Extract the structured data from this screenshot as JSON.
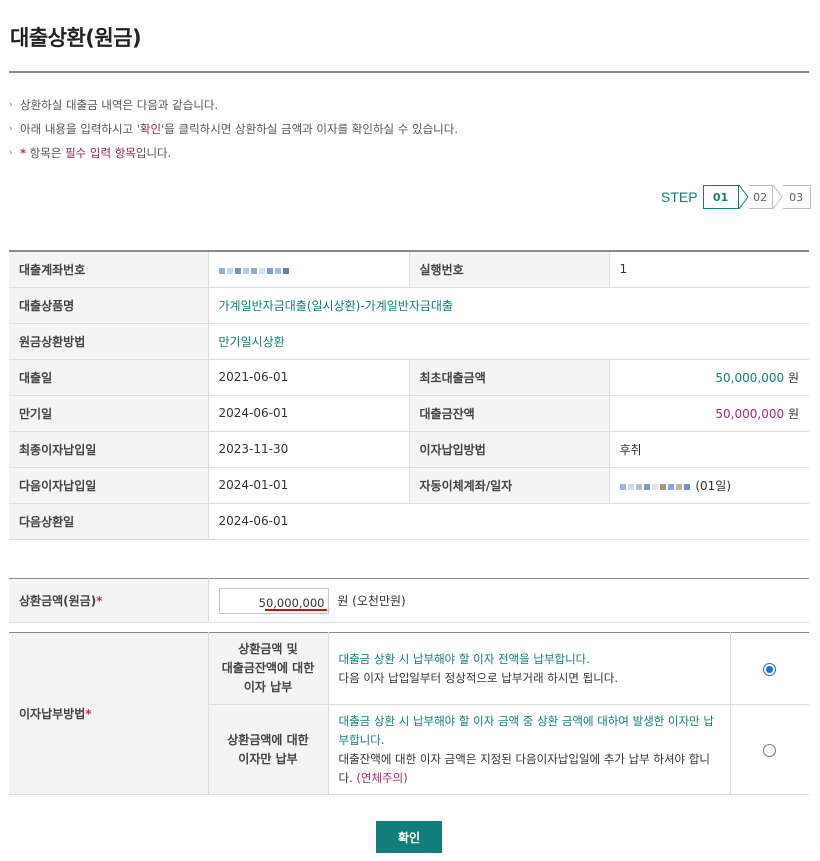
{
  "title": "대출상환(원금)",
  "notes": [
    {
      "pre": "상환하실 대출금 내역은 다음과 같습니다.",
      "hl": "",
      "post": ""
    },
    {
      "pre": "아래 내용을 입력하시고 ",
      "hl": "'확인'",
      "post": "을 클릭하시면 상환하실 금액과 이자를 확인하실 수 있습니다."
    },
    {
      "pre": "",
      "hl": "필수 입력 항목",
      "post": "입니다.",
      "star": "*",
      "star_after": " 항목은 "
    }
  ],
  "steps": {
    "label": "STEP",
    "items": [
      "01",
      "02",
      "03"
    ],
    "active": "01"
  },
  "info": {
    "account_no_label": "대출계좌번호",
    "exec_no_label": "실행번호",
    "exec_no": "1",
    "product_label": "대출상품명",
    "product": "가계일반자금대출(일시상환)-가계일반자금대출",
    "method_label": "원금상환방법",
    "method": "만기일시상환",
    "loan_date_label": "대출일",
    "loan_date": "2021-06-01",
    "initial_amount_label": "최초대출금액",
    "initial_amount": "50,000,000",
    "won": "원",
    "maturity_label": "만기일",
    "maturity": "2024-06-01",
    "balance_label": "대출금잔액",
    "balance": "50,000,000",
    "last_interest_label": "최종이자납입일",
    "last_interest": "2023-11-30",
    "interest_method_label": "이자납입방법",
    "interest_method": "후취",
    "next_interest_label": "다음이자납입일",
    "next_interest": "2024-01-01",
    "auto_transfer_label": "자동이체계좌/일자",
    "auto_transfer_day": "(01일)",
    "next_repay_label": "다음상환일",
    "next_repay": "2024-06-01"
  },
  "repay": {
    "label": "상환금액(원금)",
    "star": "*",
    "amount": "50,000,000",
    "suffix": "원 (오천만원)"
  },
  "interest": {
    "label": "이자납부방법",
    "star": "*",
    "option1": {
      "title": [
        "상환금액 및",
        "대출금잔액에 대한",
        "이자 납부"
      ],
      "desc_teal": "대출금 상환 시 납부해야 할 이자 전액을 납부합니다.",
      "desc": "다음 이자 납입일부터 정상적으로 납부거래 하시면 됩니다.",
      "checked": true
    },
    "option2": {
      "title": [
        "상환금액에 대한",
        "이자만 납부"
      ],
      "desc_teal": "대출금 상환 시 납부해야 할 이자 금액 중 상환 금액에 대하여 발생한 이자만 납부합니다.",
      "desc": "대출잔액에 대한 이자 금액은 지정된 다음이자납입일에 추가 납부 하셔야 합니다.",
      "warn": "(연체주의)",
      "checked": false
    }
  },
  "confirm_label": "확인",
  "colors": {
    "accent": "#137d7a",
    "plum": "#a02f6b",
    "radio": "#1f6ee0"
  }
}
